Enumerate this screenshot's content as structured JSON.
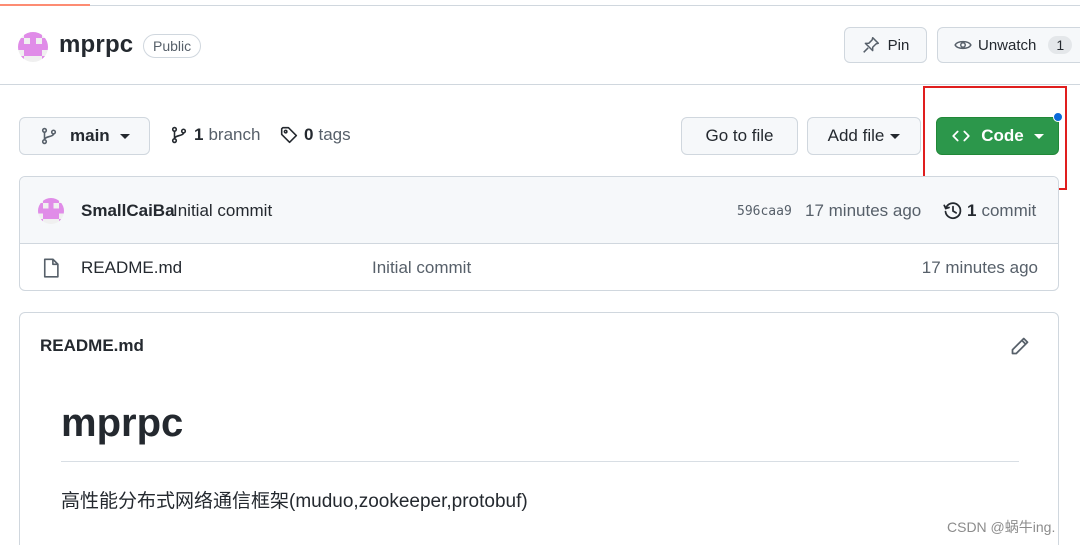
{
  "header": {
    "repo_name": "mprpc",
    "visibility": "Public",
    "pin_label": "Pin",
    "watch_label": "Unwatch",
    "watch_count": "1"
  },
  "toolbar": {
    "branch_name": "main",
    "branch_count": "1",
    "branch_label": "branch",
    "tag_count": "0",
    "tag_label": "tags",
    "go_to_file": "Go to file",
    "add_file": "Add file",
    "code": "Code"
  },
  "commit": {
    "author": "SmallCaiBa",
    "message": "Initial commit",
    "sha": "596caa9",
    "time": "17 minutes ago",
    "count": "1",
    "count_label": "commit"
  },
  "files": [
    {
      "name": "README.md",
      "commit_message": "Initial commit",
      "time": "17 minutes ago"
    }
  ],
  "readme": {
    "title": "README.md",
    "heading": "mprpc",
    "description": "高性能分布式网络通信框架(muduo,zookeeper,protobuf)"
  },
  "watermark": "CSDN @蜗牛ing.",
  "colors": {
    "code_button": "#2c974b",
    "highlight": "#e01e1e",
    "notification_dot": "#0969da",
    "avatar": "#e08ce8"
  }
}
